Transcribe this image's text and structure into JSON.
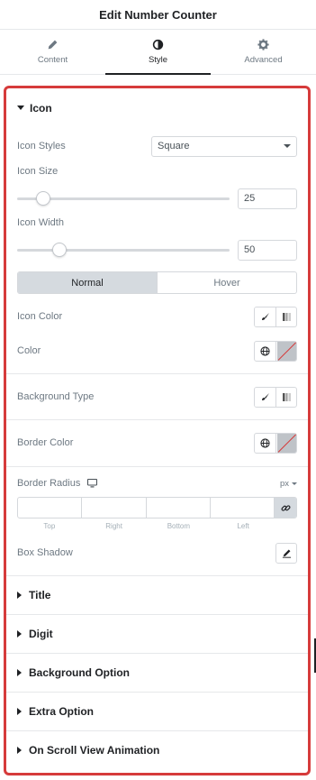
{
  "header": {
    "title": "Edit Number Counter"
  },
  "tabs": [
    {
      "label": "Content",
      "icon": "pencil-icon",
      "active": false
    },
    {
      "label": "Style",
      "icon": "half-circle-icon",
      "active": true
    },
    {
      "label": "Advanced",
      "icon": "gear-icon",
      "active": false
    }
  ],
  "icon_section": {
    "title": "Icon",
    "icon_styles": {
      "label": "Icon Styles",
      "value": "Square"
    },
    "icon_size": {
      "label": "Icon Size",
      "value": "25",
      "slider_fraction": 0.12
    },
    "icon_width": {
      "label": "Icon Width",
      "value": "50",
      "slider_fraction": 0.2
    },
    "state_toggle": {
      "normal": "Normal",
      "hover": "Hover",
      "active": "Normal"
    },
    "icon_color": {
      "label": "Icon Color"
    },
    "color": {
      "label": "Color"
    },
    "background_type": {
      "label": "Background Type"
    },
    "border_color": {
      "label": "Border Color"
    },
    "border_radius": {
      "label": "Border Radius",
      "unit": "px",
      "fields": [
        "Top",
        "Right",
        "Bottom",
        "Left"
      ]
    },
    "box_shadow": {
      "label": "Box Shadow"
    }
  },
  "collapsed_sections": [
    {
      "title": "Title"
    },
    {
      "title": "Digit"
    },
    {
      "title": "Background Option"
    },
    {
      "title": "Extra Option"
    },
    {
      "title": "On Scroll View Animation"
    }
  ],
  "colors": {
    "highlight_border": "#d63b3b",
    "text_dark": "#1f2124",
    "text_muted": "#6d7882"
  }
}
